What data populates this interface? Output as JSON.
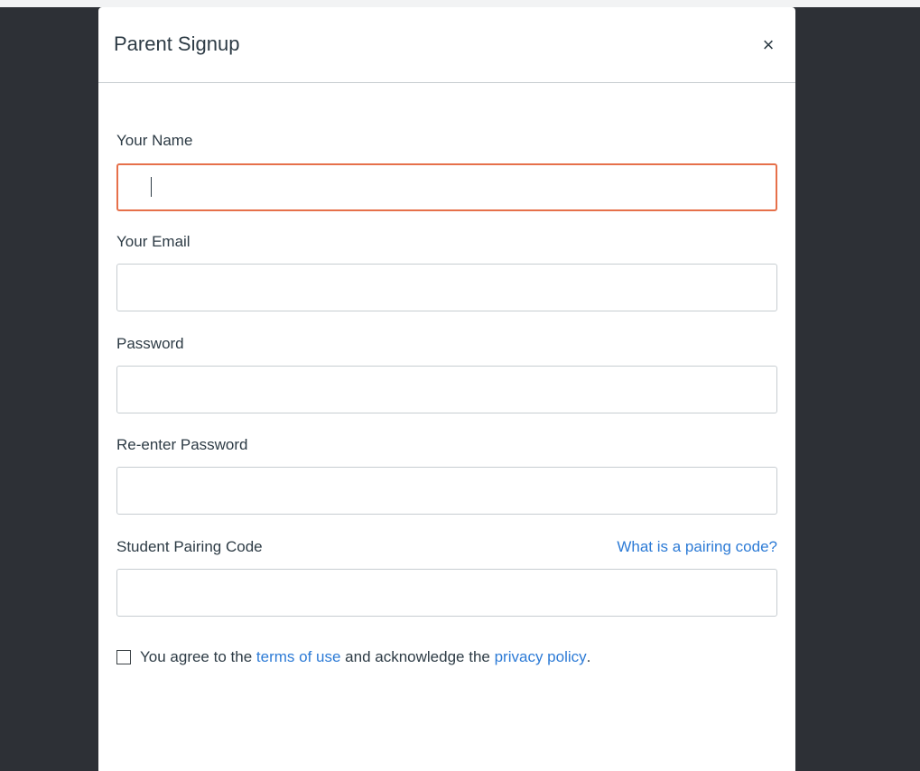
{
  "modal": {
    "title": "Parent Signup",
    "close_symbol": "×"
  },
  "form": {
    "name": {
      "label": "Your Name",
      "value": ""
    },
    "email": {
      "label": "Your Email",
      "value": ""
    },
    "password": {
      "label": "Password",
      "value": ""
    },
    "password_confirm": {
      "label": "Re-enter Password",
      "value": ""
    },
    "pairing_code": {
      "label": "Student Pairing Code",
      "value": "",
      "help_link": "What is a pairing code?"
    },
    "agreement": {
      "prefix": "You agree to the",
      "terms_link": "terms of use",
      "middle": "and acknowledge the",
      "privacy_link": "privacy policy",
      "suffix": ".",
      "checked": false
    }
  },
  "colors": {
    "backdrop": "#2d3036",
    "focus_border": "#e6704a",
    "link": "#2d7bd6",
    "text": "#2d3b45"
  }
}
